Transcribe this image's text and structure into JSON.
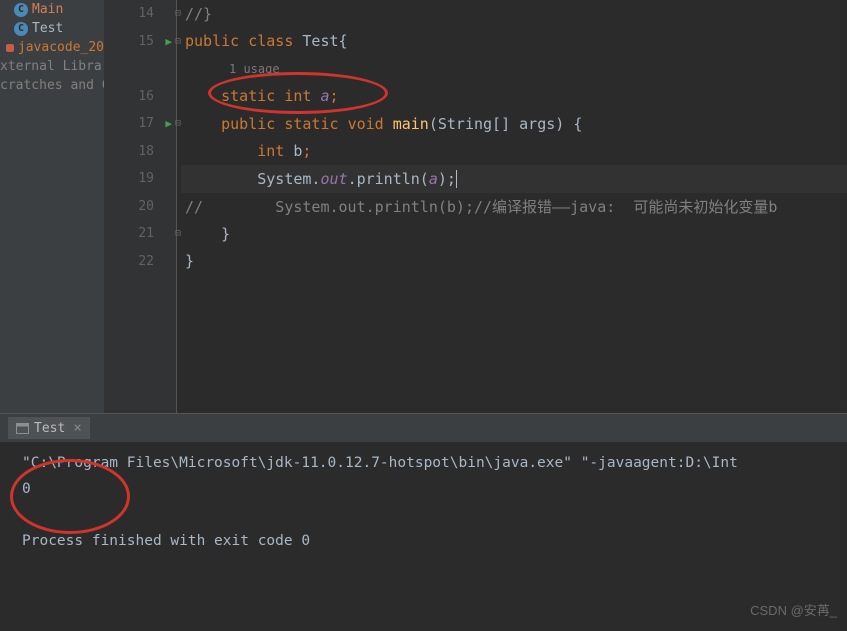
{
  "sidebar": {
    "items": [
      {
        "label": "Main",
        "icon": "C",
        "cls": "main-item"
      },
      {
        "label": "Test",
        "icon": "C",
        "cls": "test-item"
      },
      {
        "label": "javacode_20",
        "icon": "dot",
        "cls": "javacode"
      },
      {
        "label": "xternal Librarie",
        "icon": "",
        "cls": "lib-item"
      },
      {
        "label": "cratches and C",
        "icon": "",
        "cls": "lib-item"
      }
    ]
  },
  "editor": {
    "usage_hint": "1 usage",
    "lines": [
      {
        "n": "14",
        "run": false,
        "fold": "⊟",
        "tokens": [
          {
            "t": "//}",
            "c": "cm"
          }
        ]
      },
      {
        "n": "15",
        "run": true,
        "fold": "⊟",
        "tokens": [
          {
            "t": "public ",
            "c": "kw"
          },
          {
            "t": "class ",
            "c": "kw"
          },
          {
            "t": "Test{",
            "c": ""
          }
        ]
      },
      {
        "n": "",
        "usage": true
      },
      {
        "n": "16",
        "run": false,
        "fold": "",
        "tokens": [
          {
            "t": "    ",
            "c": ""
          },
          {
            "t": "static ",
            "c": "kw"
          },
          {
            "t": "int ",
            "c": "kw"
          },
          {
            "t": "a",
            "c": "st"
          },
          {
            "t": ";",
            "c": "kw"
          }
        ]
      },
      {
        "n": "17",
        "run": true,
        "fold": "⊟",
        "tokens": [
          {
            "t": "    ",
            "c": ""
          },
          {
            "t": "public ",
            "c": "kw"
          },
          {
            "t": "static ",
            "c": "kw"
          },
          {
            "t": "void ",
            "c": "kw"
          },
          {
            "t": "main",
            "c": "fn"
          },
          {
            "t": "(String[] args) {",
            "c": ""
          }
        ]
      },
      {
        "n": "18",
        "run": false,
        "fold": "",
        "tokens": [
          {
            "t": "        ",
            "c": ""
          },
          {
            "t": "int ",
            "c": "kw"
          },
          {
            "t": "b",
            "c": ""
          },
          {
            "t": ";",
            "c": "kw"
          }
        ]
      },
      {
        "n": "19",
        "run": false,
        "fold": "",
        "hl": true,
        "tokens": [
          {
            "t": "        System.",
            "c": ""
          },
          {
            "t": "out",
            "c": "st"
          },
          {
            "t": ".println(",
            "c": ""
          },
          {
            "t": "a",
            "c": "it st"
          },
          {
            "t": ");",
            "c": ""
          }
        ],
        "cursor": true
      },
      {
        "n": "20",
        "run": false,
        "fold": "",
        "tokens": [
          {
            "t": "//        System.out.println(b);//编译报错——java:  可能尚未初始化变量b",
            "c": "cm"
          }
        ]
      },
      {
        "n": "21",
        "run": false,
        "fold": "⊟",
        "tokens": [
          {
            "t": "    }",
            "c": ""
          }
        ]
      },
      {
        "n": "22",
        "run": false,
        "fold": "",
        "tokens": [
          {
            "t": "}",
            "c": ""
          }
        ]
      }
    ]
  },
  "console": {
    "tab_label": "Test",
    "lines": [
      "\"C:\\Program Files\\Microsoft\\jdk-11.0.12.7-hotspot\\bin\\java.exe\" \"-javaagent:D:\\Int",
      "0",
      "",
      "Process finished with exit code 0"
    ]
  },
  "watermark": "CSDN @安苒_"
}
